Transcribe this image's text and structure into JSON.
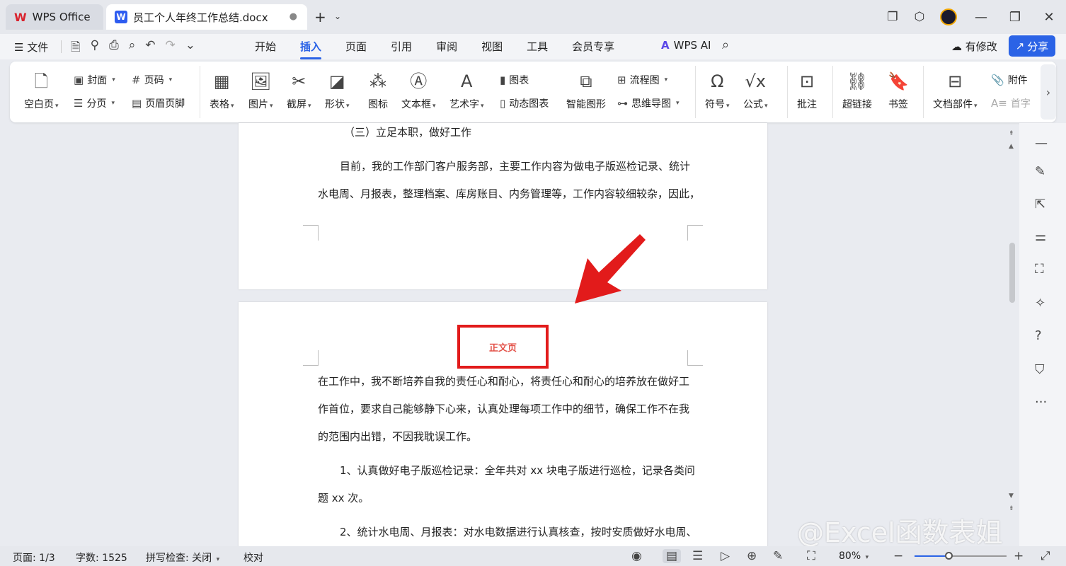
{
  "titlebar": {
    "app_tab": "WPS Office",
    "doc_tab": "员工个人年终工作总结.docx",
    "unsaved_dot": "●",
    "new_tab": "+"
  },
  "menubar": {
    "file": "文件",
    "tabs": [
      "开始",
      "插入",
      "页面",
      "引用",
      "审阅",
      "视图",
      "工具",
      "会员专享"
    ],
    "active_tab": "插入",
    "wps_ai": "WPS AI",
    "modified": "有修改",
    "share": "分享"
  },
  "ribbon": {
    "blank_page": "空白页",
    "cover": "封面",
    "page_break": "分页",
    "page_number": "页码",
    "header_footer": "页眉页脚",
    "table": "表格",
    "picture": "图片",
    "screenshot": "截屏",
    "shape": "形状",
    "icon": "图标",
    "text_box": "文本框",
    "word_art": "艺术字",
    "chart": "图表",
    "dynamic_chart": "动态图表",
    "smart_graphic": "智能图形",
    "flowchart": "流程图",
    "mind_map": "思维导图",
    "symbol": "符号",
    "formula": "公式",
    "comment": "批注",
    "hyperlink": "超链接",
    "bookmark": "书签",
    "doc_parts": "文档部件",
    "attachment": "附件",
    "drop_cap": "首字"
  },
  "document": {
    "page1": {
      "heading": "（三）立足本职，做好工作",
      "line1": "目前，我的工作部门客户服务部，主要工作内容为做电子版巡检记录、统计",
      "line2": "水电周、月报表，整理档案、库房账目、内务管理等，工作内容较细较杂，因此，"
    },
    "highlight_label": "正文页",
    "page2": {
      "line1": "在工作中，我不断培养自我的责任心和耐心，将责任心和耐心的培养放在做好工",
      "line2": "作首位，要求自己能够静下心来，认真处理每项工作中的细节，确保工作不在我",
      "line3": "的范围内出错，不因我耽误工作。",
      "line4": "1、认真做好电子版巡检记录：全年共对 xx 块电子版进行巡检，记录各类问",
      "line5": "题 xx 次。",
      "line6": "2、统计水电周、月报表：对水电数据进行认真核查，按时安质做好水电周、"
    }
  },
  "statusbar": {
    "page": "页面: 1/3",
    "word_count": "字数: 1525",
    "spell_check": "拼写检查: 关闭",
    "proofread": "校对",
    "zoom": "80%",
    "zoom_percent": 80
  },
  "watermark": "@Excel函数表姐",
  "colors": {
    "accent": "#2b63e6",
    "highlight_red": "#e21b1b",
    "wps_red": "#d9232e"
  }
}
